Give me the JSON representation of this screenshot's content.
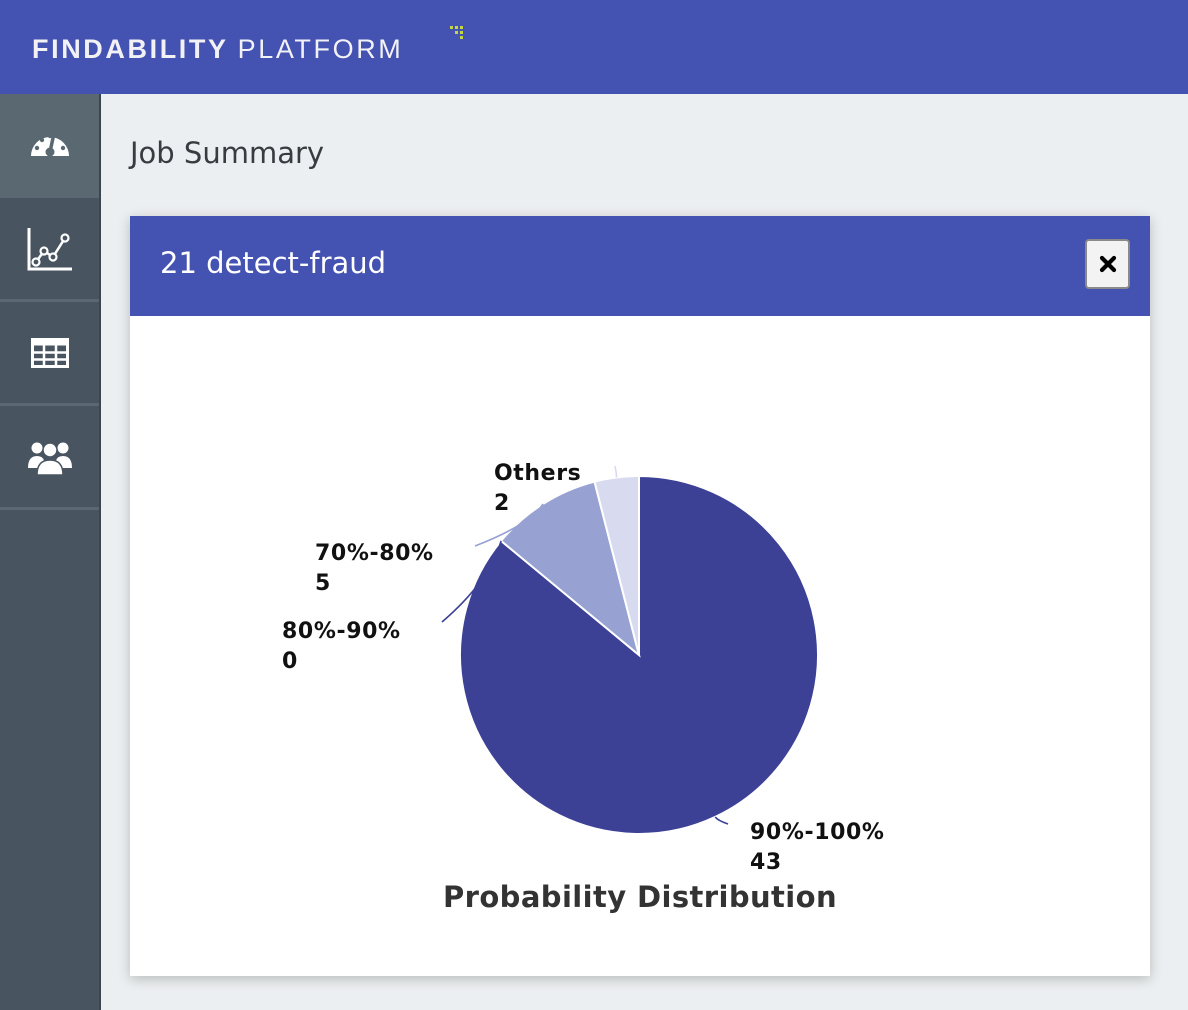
{
  "header": {
    "brand_primary": "FINDABILITY",
    "brand_secondary": "PLATFORM",
    "brand_bg": "#4452b1",
    "brand_dots_color": "#c4d640"
  },
  "sidebar": {
    "items": [
      {
        "icon": "dashboard-gauge-icon",
        "active": true
      },
      {
        "icon": "line-chart-icon",
        "active": false
      },
      {
        "icon": "table-grid-icon",
        "active": false
      },
      {
        "icon": "users-group-icon",
        "active": false
      }
    ]
  },
  "page": {
    "title": "Job Summary"
  },
  "card": {
    "title": "21 detect-fraud",
    "close_icon": "close-x-icon"
  },
  "chart_data": {
    "type": "pie",
    "title": "Probability Distribution",
    "categories": [
      "90%-100%",
      "80%-90%",
      "70%-80%",
      "Others"
    ],
    "values": [
      43,
      0,
      5,
      2
    ],
    "colors": [
      "#3c4196",
      "#3c4196",
      "#97a1d2",
      "#d8dbef"
    ],
    "start_angle": "top",
    "direction": "clockwise",
    "legend": "none",
    "data_labels": "outside with leader lines"
  }
}
